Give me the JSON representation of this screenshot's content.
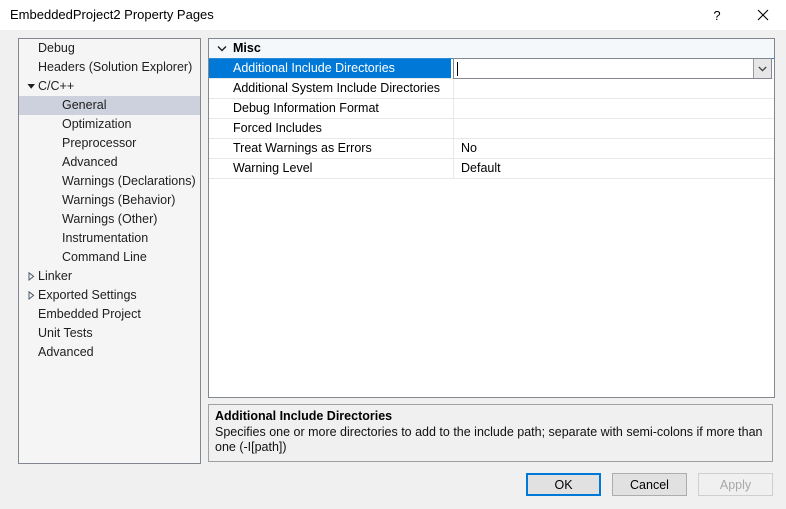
{
  "window": {
    "title": "EmbeddedProject2 Property Pages",
    "help_icon": "question-mark-icon",
    "close_icon": "close-icon"
  },
  "tree": {
    "items": [
      {
        "label": "Debug",
        "indent": 0,
        "expander": "none",
        "selected": false
      },
      {
        "label": "Headers (Solution Explorer)",
        "indent": 0,
        "expander": "none",
        "selected": false
      },
      {
        "label": "C/C++",
        "indent": 0,
        "expander": "expanded",
        "selected": false
      },
      {
        "label": "General",
        "indent": 1,
        "expander": "none",
        "selected": true
      },
      {
        "label": "Optimization",
        "indent": 1,
        "expander": "none",
        "selected": false
      },
      {
        "label": "Preprocessor",
        "indent": 1,
        "expander": "none",
        "selected": false
      },
      {
        "label": "Advanced",
        "indent": 1,
        "expander": "none",
        "selected": false
      },
      {
        "label": "Warnings (Declarations)",
        "indent": 1,
        "expander": "none",
        "selected": false
      },
      {
        "label": "Warnings (Behavior)",
        "indent": 1,
        "expander": "none",
        "selected": false
      },
      {
        "label": "Warnings (Other)",
        "indent": 1,
        "expander": "none",
        "selected": false
      },
      {
        "label": "Instrumentation",
        "indent": 1,
        "expander": "none",
        "selected": false
      },
      {
        "label": "Command Line",
        "indent": 1,
        "expander": "none",
        "selected": false
      },
      {
        "label": "Linker",
        "indent": 0,
        "expander": "collapsed",
        "selected": false
      },
      {
        "label": "Exported Settings",
        "indent": 0,
        "expander": "collapsed",
        "selected": false
      },
      {
        "label": "Embedded Project",
        "indent": 0,
        "expander": "none",
        "selected": false
      },
      {
        "label": "Unit Tests",
        "indent": 0,
        "expander": "none",
        "selected": false
      },
      {
        "label": "Advanced",
        "indent": 0,
        "expander": "none",
        "selected": false
      }
    ]
  },
  "grid": {
    "category": "Misc",
    "category_expander": "chevron-down-icon",
    "rows": [
      {
        "name": "Additional Include Directories",
        "value": "",
        "selected": true,
        "editing": true
      },
      {
        "name": "Additional System Include Directories",
        "value": "",
        "selected": false,
        "editing": false
      },
      {
        "name": "Debug Information Format",
        "value": "",
        "selected": false,
        "editing": false
      },
      {
        "name": "Forced Includes",
        "value": "",
        "selected": false,
        "editing": false
      },
      {
        "name": "Treat Warnings as Errors",
        "value": "No",
        "selected": false,
        "editing": false
      },
      {
        "name": "Warning Level",
        "value": "Default",
        "selected": false,
        "editing": false
      }
    ],
    "editor": {
      "value": "",
      "dropdown_icon": "chevron-down-icon"
    }
  },
  "description": {
    "title": "Additional Include Directories",
    "text": "Specifies one or more directories to add to the include path; separate with semi-colons if more than one (-I[path])"
  },
  "buttons": {
    "ok": "OK",
    "cancel": "Cancel",
    "apply": "Apply"
  },
  "colors": {
    "selection_blue": "#0078d7",
    "tree_selection": "#cdd0dd",
    "dialog_background": "#f0f0f0",
    "panel_border": "#828790",
    "category_underline": "#2a8ad4"
  }
}
